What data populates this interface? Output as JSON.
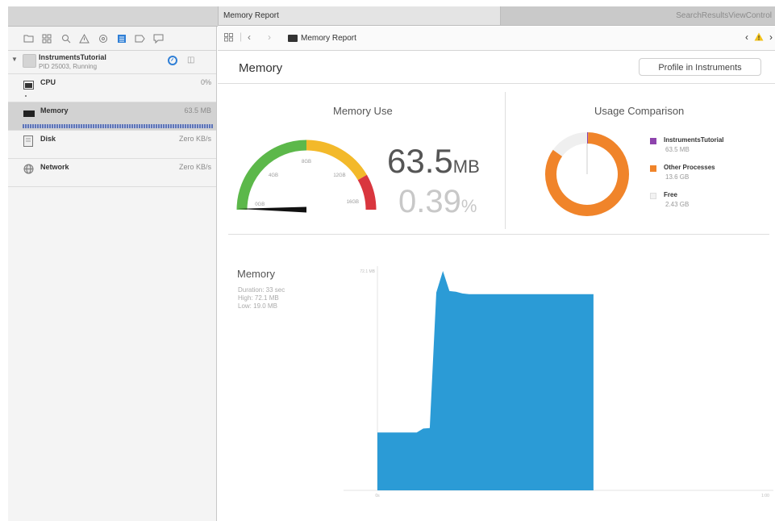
{
  "tabs": {
    "active": "Memory Report",
    "inactive": "SearchResultsViewControl"
  },
  "navigator": {
    "toolbar_icons": [
      "folder-icon",
      "symbol-icon",
      "search-icon",
      "warning-icon",
      "test-icon",
      "debug-icon",
      "breakpoint-icon",
      "log-icon"
    ],
    "process": {
      "name": "InstrumentsTutorial",
      "status": "PID 25003, Running"
    },
    "gauges": [
      {
        "label": "CPU",
        "value": "0%"
      },
      {
        "label": "Memory",
        "value": "63.5 MB"
      },
      {
        "label": "Disk",
        "value": "Zero KB/s"
      },
      {
        "label": "Network",
        "value": "Zero KB/s"
      }
    ]
  },
  "jumpbar": {
    "crumb": "Memory Report"
  },
  "report": {
    "title": "Memory",
    "profile_button": "Profile in Instruments"
  },
  "memory_use": {
    "title": "Memory Use",
    "value": "63.5",
    "value_unit": "MB",
    "percent": "0.39",
    "percent_unit": "%",
    "gauge_ticks": [
      "0GB",
      "4GB",
      "8GB",
      "12GB",
      "16GB"
    ],
    "gauge_fraction": 0.004,
    "colors": {
      "green": "#5cb84a",
      "yellow": "#f3b92a",
      "red": "#d9363e"
    }
  },
  "usage_comparison": {
    "title": "Usage Comparison",
    "legend": [
      {
        "name": "InstrumentsTutorial",
        "value": "63.5 MB",
        "color": "#8e44ad"
      },
      {
        "name": "Other Processes",
        "value": "13.6 GB",
        "color": "#f0842a"
      },
      {
        "name": "Free",
        "value": "2.43 GB",
        "color": "#efefef"
      }
    ]
  },
  "memory_chart": {
    "label": "Memory",
    "duration": "Duration: 33 sec",
    "high": "High: 72.1 MB",
    "low": "Low: 19.0 MB"
  },
  "chart_data": [
    {
      "type": "pie",
      "title": "Usage Comparison",
      "labels": [
        "InstrumentsTutorial",
        "Other Processes",
        "Free"
      ],
      "values": [
        0.0635,
        13.6,
        2.43
      ],
      "units": "GB",
      "colors": [
        "#8e44ad",
        "#f0842a",
        "#efefef"
      ]
    },
    {
      "type": "area",
      "title": "Memory",
      "ytick_label": "72.1 MB",
      "xtick_labels": [
        "0s",
        "1:00"
      ],
      "x": [
        0,
        6,
        7,
        8,
        9,
        10,
        11,
        12,
        13,
        14,
        15,
        33
      ],
      "y": [
        19.0,
        19.0,
        20.3,
        20.5,
        65.0,
        72.1,
        65.5,
        65.3,
        64.7,
        64.5,
        64.5,
        64.5
      ],
      "xlim": [
        0,
        60
      ],
      "ylim": [
        0,
        72.1
      ],
      "color": "#2b9bd6"
    }
  ]
}
